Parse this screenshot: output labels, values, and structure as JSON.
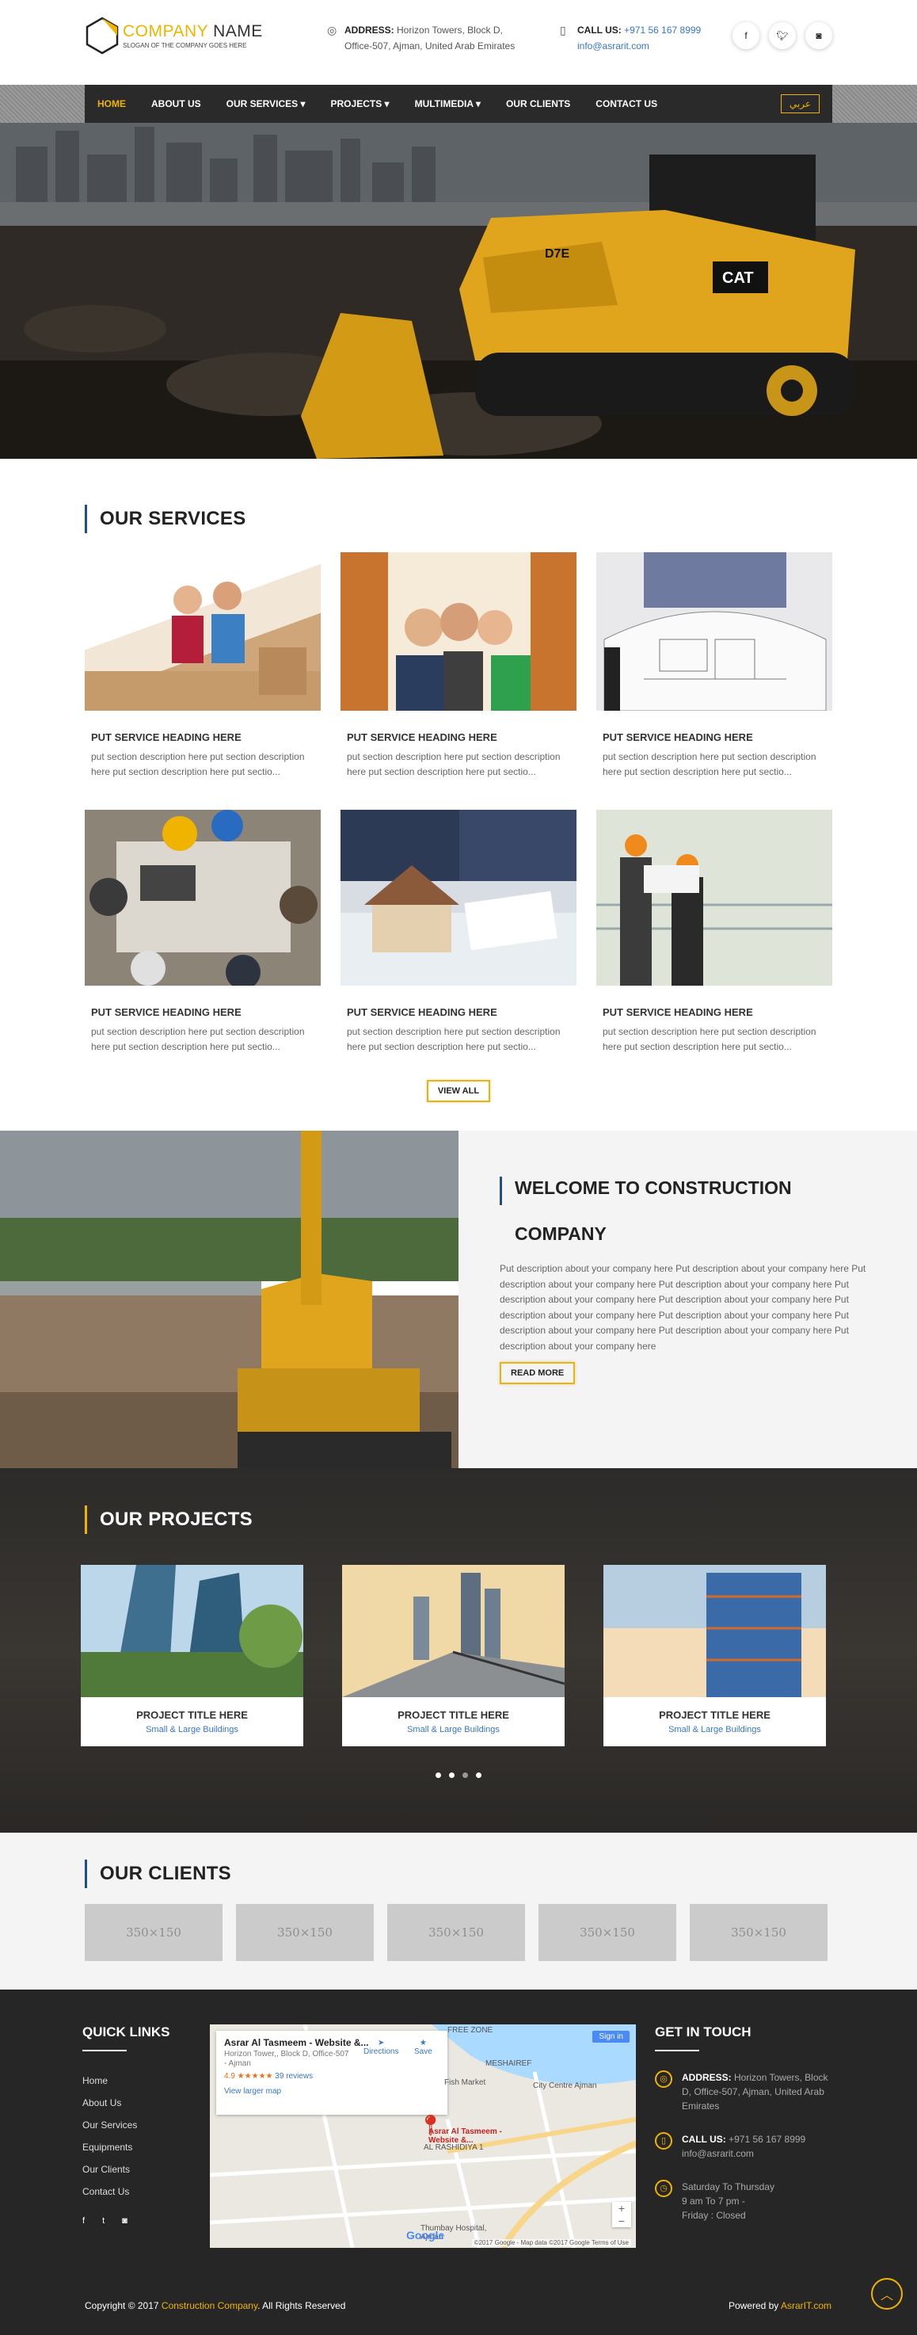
{
  "header": {
    "brand_company": "COMPANY",
    "brand_name": "NAME",
    "slogan": "SLOGAN OF THE COMPANY GOES HERE",
    "address_label": "ADDRESS:",
    "address_line1": "Horizon Towers, Block D,",
    "address_line2": "Office-507, Ajman, United Arab Emirates",
    "call_label": "CALL US:",
    "phone": "+971 56 167 8999",
    "email": "info@asrarit.com",
    "social": [
      "f",
      "t",
      "ig"
    ]
  },
  "nav": {
    "items": [
      "HOME",
      "ABOUT US",
      "OUR SERVICES",
      "PROJECTS",
      "MULTIMEDIA",
      "OUR CLIENTS",
      "CONTACT US"
    ],
    "arabic": "عربي"
  },
  "services": {
    "title": "OUR SERVICES",
    "items": [
      {
        "heading": "PUT SERVICE HEADING HERE",
        "desc": "put section description here put section description here put section description here put sectio..."
      },
      {
        "heading": "PUT SERVICE HEADING HERE",
        "desc": "put section description here put section description here put section description here put sectio..."
      },
      {
        "heading": "PUT SERVICE HEADING HERE",
        "desc": "put section description here put section description here put section description here put sectio..."
      },
      {
        "heading": "PUT SERVICE HEADING HERE",
        "desc": "put section description here put section description here put section description here put sectio..."
      },
      {
        "heading": "PUT SERVICE HEADING HERE",
        "desc": "put section description here put section description here put section description here put sectio..."
      },
      {
        "heading": "PUT SERVICE HEADING HERE",
        "desc": "put section description here put section description here put section description here put sectio..."
      }
    ],
    "view_all": "VIEW ALL"
  },
  "welcome": {
    "title_line1": "WELCOME TO CONSTRUCTION",
    "title_line2": "COMPANY",
    "text": "Put description about your company here Put description about your company here Put description about your company here Put description about your company here Put description about your company here Put description about your company here Put description about your company here Put description about your company here Put description about your company here Put description about your company here Put description about your company here",
    "read_more": "READ MORE"
  },
  "projects": {
    "title": "OUR PROJECTS",
    "items": [
      {
        "title": "PROJECT TITLE HERE",
        "sub": "Small & Large Buildings"
      },
      {
        "title": "PROJECT TITLE HERE",
        "sub": "Small & Large Buildings"
      },
      {
        "title": "PROJECT TITLE HERE",
        "sub": "Small & Large Buildings"
      }
    ]
  },
  "clients": {
    "title": "OUR CLIENTS",
    "placeholder": "350×150"
  },
  "footer": {
    "quick_links_title": "QUICK LINKS",
    "links": [
      "Home",
      "About Us",
      "Our Services",
      "Equipments",
      "Our Clients",
      "Contact Us"
    ],
    "social": [
      "f",
      "t",
      "ig"
    ],
    "map": {
      "name": "Asrar Al Tasmeem - Website &...",
      "address": "Horizon Tower,, Block D, Office-507 - Ajman",
      "rating": "4.9 ★★★★★",
      "reviews": "39 reviews",
      "larger": "View larger map",
      "directions": "Directions",
      "save": "Save",
      "signin": "Sign in",
      "pin_label": "Asrar Al Tasmeem - Website &...",
      "lbl_fish": "Fish Market",
      "lbl_mesh": "MESHAIREF",
      "lbl_city": "City Centre Ajman",
      "lbl_rash": "AL RASHIDIYA 1",
      "lbl_thumbay": "Thumbay Hospital, Ajman",
      "free_zone": "FREE ZONE",
      "copyright": "©2017 Google - Map data ©2017 Google   Terms of Use"
    },
    "touch_title": "GET IN TOUCH",
    "address_label": "ADDRESS:",
    "address": "Horizon Towers, Block D, Office-507, Ajman, United Arab Emirates",
    "call_label": "CALL US:",
    "phone": "+971 56 167 8999",
    "email": "info@asrarit.com",
    "hours1": "Saturday To Thursday",
    "hours2": "9 am To 7 pm -",
    "hours3": "Friday : Closed",
    "copyright_pre": "Copyright © 2017",
    "copyright_company": "Construction Company",
    "copyright_post": ". All Rights Reserved",
    "powered_pre": "Powered by",
    "powered_link": "AsrarIT.com"
  },
  "colors": {
    "accent": "#f0b400",
    "title_bar": "#1f4f86",
    "link": "#3a76c4"
  }
}
